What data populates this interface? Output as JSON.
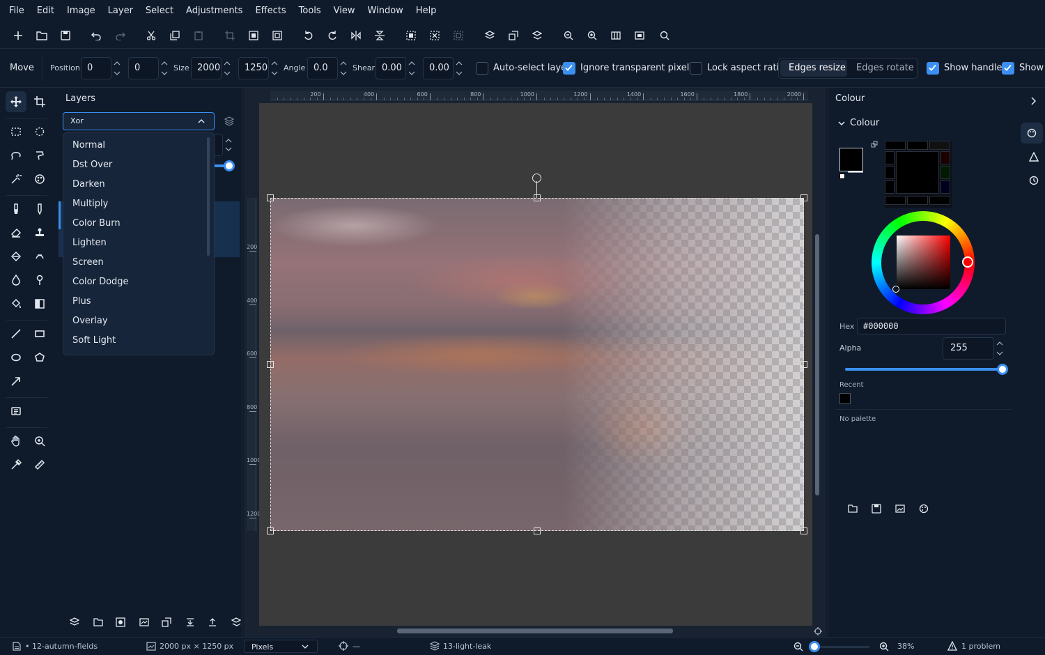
{
  "menu": [
    "File",
    "Edit",
    "Image",
    "Layer",
    "Select",
    "Adjustments",
    "Effects",
    "Tools",
    "View",
    "Window",
    "Help"
  ],
  "options": {
    "tool_name": "Move",
    "position_label": "Position",
    "pos_x": "0",
    "pos_y": "0",
    "size_label": "Size",
    "width": "2000",
    "height": "1250",
    "angle_label": "Angle",
    "angle": "0.0",
    "shear_label": "Shear",
    "shear_x": "0.00",
    "shear_y": "0.00",
    "auto_select": "Auto-select layer",
    "ignore_transparent": "Ignore transparent pixels",
    "lock_aspect": "Lock aspect ratio",
    "edges_resize": "Edges resize",
    "edges_rotate": "Edges rotate",
    "show_handles": "Show handles",
    "show_partial": "Show"
  },
  "layers": {
    "title": "Layers",
    "blend_selected": "Xor",
    "blend_options": [
      "Normal",
      "Dst Over",
      "Darken",
      "Multiply",
      "Color Burn",
      "Lighten",
      "Screen",
      "Color Dodge",
      "Plus",
      "Overlay",
      "Soft Light"
    ]
  },
  "ruler": {
    "h_ticks": [
      "200",
      "400",
      "600",
      "800",
      "1000",
      "1200",
      "1400",
      "1600",
      "1800",
      "2000"
    ],
    "v_ticks": [
      "200",
      "400",
      "600",
      "800",
      "1000",
      "1200"
    ]
  },
  "colour": {
    "panel_title": "Colour",
    "section_title": "Colour",
    "hex_label": "Hex",
    "hex_value": "#000000",
    "alpha_label": "Alpha",
    "alpha_value": "255",
    "alpha_fraction": 1.0,
    "recent_label": "Recent",
    "no_palette": "No palette",
    "primary": "#000000",
    "secondary": "#ffffff",
    "hue_handle": "#ff0000"
  },
  "status": {
    "document": "• 12-autumn-fields",
    "dimensions": "2000 px × 1250 px",
    "units": "Pixels",
    "cursor": "—",
    "layer": "13-light-leak",
    "zoom": "38%",
    "problems": "1 problem"
  },
  "colors": {
    "accent": "#3b8ff0",
    "bg": "#0f1b2b",
    "canvas_bg": "#3b3b3b"
  }
}
